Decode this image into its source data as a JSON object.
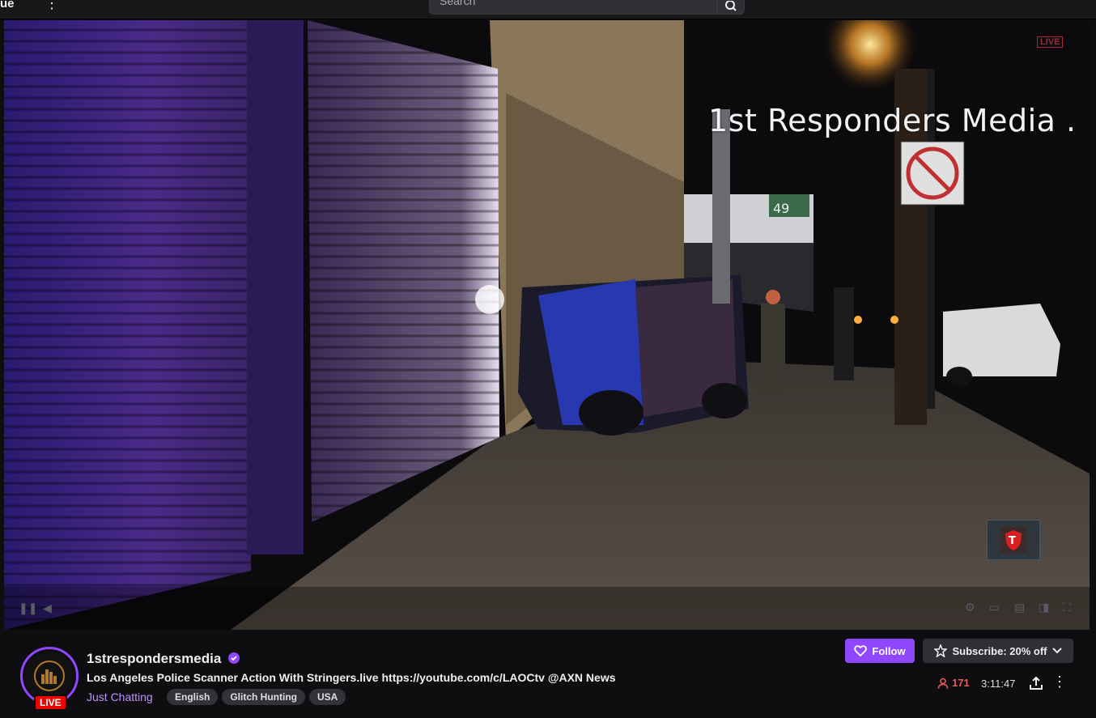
{
  "topbar": {
    "logo_fragment": "ue",
    "search_placeholder": "Search"
  },
  "video": {
    "overlay_title": "1st Responders Media .",
    "live_badge": "LIVE",
    "sign_number": "49"
  },
  "channel": {
    "name": "1strespondersmedia",
    "live_badge": "LIVE",
    "title": "Los Angeles Police Scanner Action With Stringers.live https://youtube.com/c/LAOCtv @AXN News",
    "category": "Just Chatting",
    "tags": [
      "English",
      "Glitch Hunting",
      "USA"
    ]
  },
  "actions": {
    "follow_label": "Follow",
    "subscribe_label": "Subscribe: 20% off"
  },
  "stats": {
    "viewers": "171",
    "uptime": "3:11:47"
  },
  "colors": {
    "accent": "#9147ff",
    "live": "#eb0400",
    "viewer_count": "#eb5a5a",
    "category_link": "#bf94ff"
  }
}
